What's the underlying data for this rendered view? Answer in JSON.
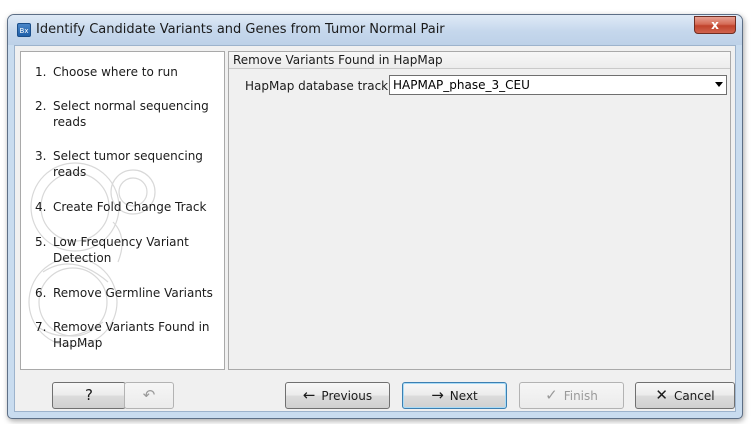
{
  "window": {
    "title": "Identify Candidate Variants and Genes from Tumor Normal Pair",
    "app_icon_text": "Bx",
    "close_label": "x"
  },
  "steps": [
    {
      "num": "1.",
      "label": "Choose where to run"
    },
    {
      "num": "2.",
      "label": "Select normal sequencing reads"
    },
    {
      "num": "3.",
      "label": "Select tumor sequencing reads"
    },
    {
      "num": "4.",
      "label": "Create Fold Change Track"
    },
    {
      "num": "5.",
      "label": "Low Frequency Variant Detection"
    },
    {
      "num": "6.",
      "label": "Remove Germline Variants"
    },
    {
      "num": "7.",
      "label": "Remove Variants Found in HapMap"
    }
  ],
  "content": {
    "section_title": "Remove Variants Found in HapMap",
    "field_label": "HapMap database track",
    "field_value": "HAPMAP_phase_3_CEU"
  },
  "buttons": {
    "help": {
      "label": "?",
      "icon": "question-mark"
    },
    "reset": {
      "icon": "undo-arrow-icon",
      "glyph": "↶"
    },
    "previous": {
      "label": "Previous",
      "glyph": "←"
    },
    "next": {
      "label": "Next",
      "glyph": "→"
    },
    "finish": {
      "label": "Finish",
      "glyph": "✓"
    },
    "cancel": {
      "label": "Cancel",
      "glyph": "✕"
    }
  }
}
